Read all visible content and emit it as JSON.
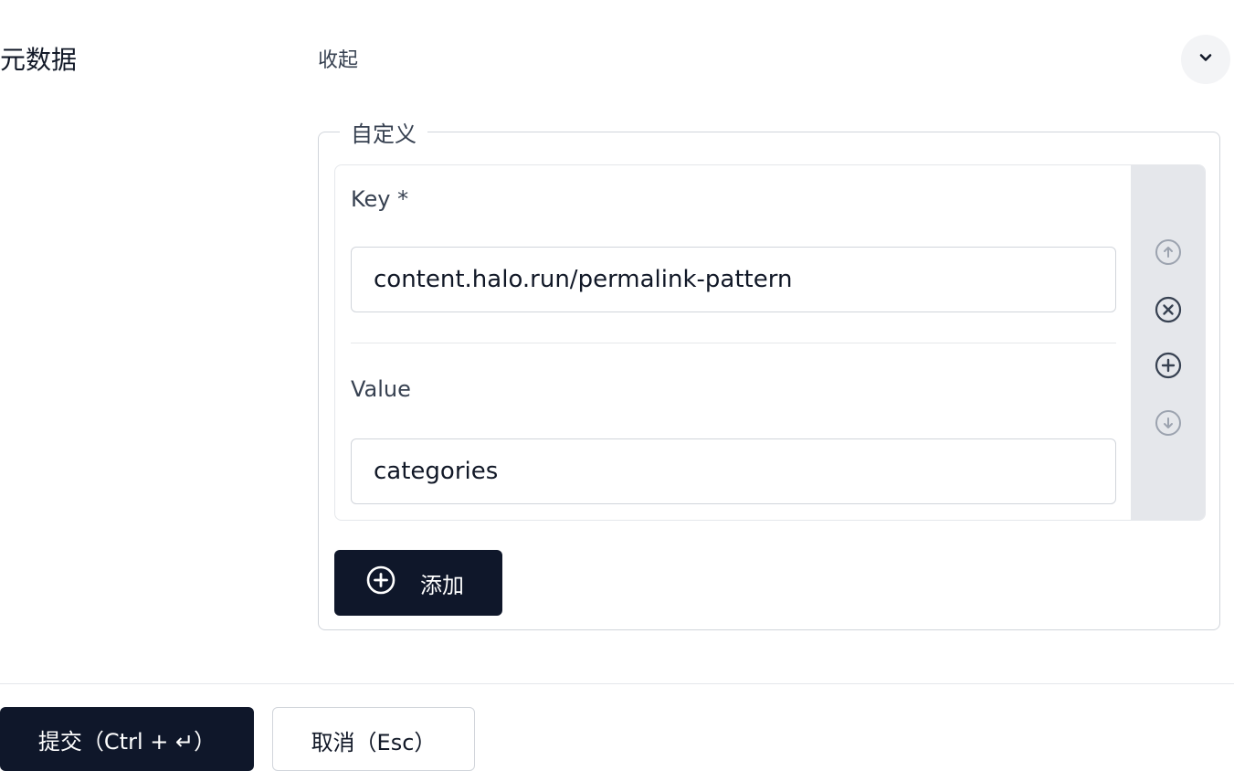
{
  "metadata_section": {
    "label": "元数据",
    "collapse_label": "收起",
    "toggle_icon": "chevron-down-icon"
  },
  "custom_group": {
    "legend": "自定义",
    "items": [
      {
        "key_label": "Key *",
        "key_value": "content.halo.run/permalink-pattern",
        "value_label": "Value",
        "value_value": "categories"
      }
    ],
    "side_icons": [
      "arrow-up-circle-icon",
      "close-circle-icon",
      "plus-circle-icon",
      "arrow-down-circle-icon"
    ],
    "add_button_label": "添加"
  },
  "footer": {
    "submit_label": "提交（Ctrl + ↵）",
    "cancel_label": "取消（Esc）"
  },
  "colors": {
    "primary": "#0f172a",
    "border": "#d1d5db",
    "side_bg": "#e5e7eb"
  }
}
